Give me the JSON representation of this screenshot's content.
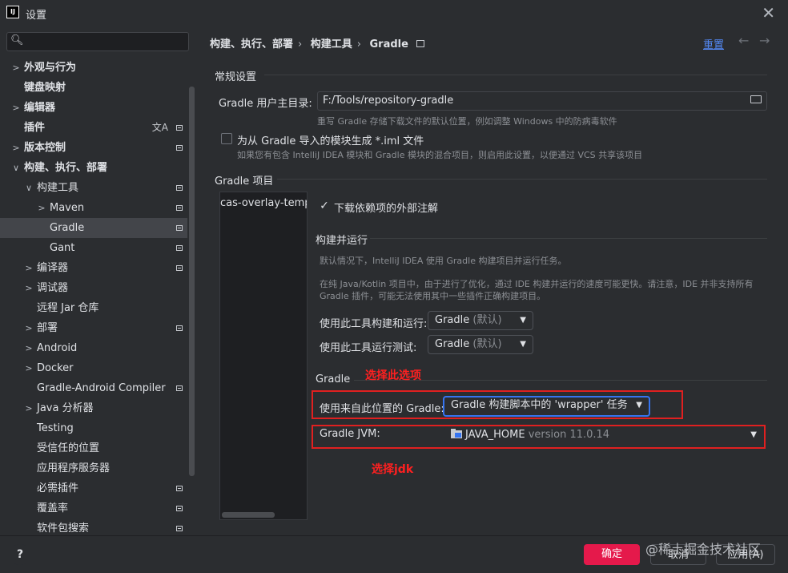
{
  "window": {
    "title": "设置",
    "close_icon": "close-icon"
  },
  "search": {
    "placeholder": "",
    "value": ""
  },
  "sidebar": {
    "items": [
      {
        "label": "外观与行为"
      },
      {
        "label": "键盘映射"
      },
      {
        "label": "编辑器"
      },
      {
        "label": "插件"
      },
      {
        "label": "版本控制"
      },
      {
        "label": "构建、执行、部署"
      },
      {
        "label": "构建工具"
      },
      {
        "label": "Maven"
      },
      {
        "label": "Gradle"
      },
      {
        "label": "Gant"
      },
      {
        "label": "编译器"
      },
      {
        "label": "调试器"
      },
      {
        "label": "远程 Jar 仓库"
      },
      {
        "label": "部署"
      },
      {
        "label": "Android"
      },
      {
        "label": "Docker"
      },
      {
        "label": "Gradle-Android Compiler"
      },
      {
        "label": "Java 分析器"
      },
      {
        "label": "Testing"
      },
      {
        "label": "受信任的位置"
      },
      {
        "label": "应用程序服务器"
      },
      {
        "label": "必需插件"
      },
      {
        "label": "覆盖率"
      },
      {
        "label": "软件包搜索"
      }
    ]
  },
  "header": {
    "breadcrumb": [
      "构建、执行、部署",
      "构建工具",
      "Gradle"
    ],
    "reset": "重置"
  },
  "general": {
    "title": "常规设置",
    "home_label": "Gradle 用户主目录:",
    "home_value": "F:/Tools/repository-gradle",
    "home_hint": "重写 Gradle 存储下载文件的默认位置，例如调整 Windows 中的防病毒软件",
    "iml_label": "为从 Gradle 导入的模块生成 *.iml 文件",
    "iml_checked": false,
    "iml_hint": "如果您有包含 IntelliJ IDEA 模块和 Gradle 模块的混合项目，则启用此设置，以便通过 VCS 共享该项目"
  },
  "projects": {
    "title": "Gradle 项目",
    "items": [
      "cas-overlay-template"
    ],
    "download_label": "下载依赖项的外部注解",
    "download_checked": true
  },
  "build_run": {
    "title": "构建并运行",
    "desc1": "默认情况下，IntelliJ IDEA 使用 Gradle 构建项目并运行任务。",
    "desc2a": "在纯 Java/Kotlin 项目中，由于进行了优化，通过 IDE 构建并运行的速度可能更快。请注意，IDE 并非支持所有",
    "desc2b": "Gradle 插件，可能无法使用其中一些插件正确构建项目。",
    "build_label": "使用此工具构建和运行:",
    "build_value": "Gradle",
    "build_default": "(默认)",
    "test_label": "使用此工具运行测试:",
    "test_value": "Gradle",
    "test_default": "(默认)"
  },
  "gradle": {
    "title": "Gradle",
    "from_label": "使用来自此位置的 Gradle:",
    "from_value": "Gradle 构建脚本中的 'wrapper' 任务",
    "jvm_label": "Gradle JVM:",
    "jvm_name": "JAVA_HOME",
    "jvm_version": "version 11.0.14"
  },
  "annotations": {
    "select_option": "选择此选项",
    "select_jdk": "选择jdk"
  },
  "footer": {
    "help": "?",
    "ok": "确定",
    "cancel": "取消",
    "apply": "应用(A)"
  },
  "watermark": "@稀土掘金技术社区",
  "colors": {
    "background": "#2b2d30",
    "primary_button": "#e5194b",
    "link": "#548af7",
    "focus": "#3574f0",
    "annotation_red": "#ff2020"
  }
}
